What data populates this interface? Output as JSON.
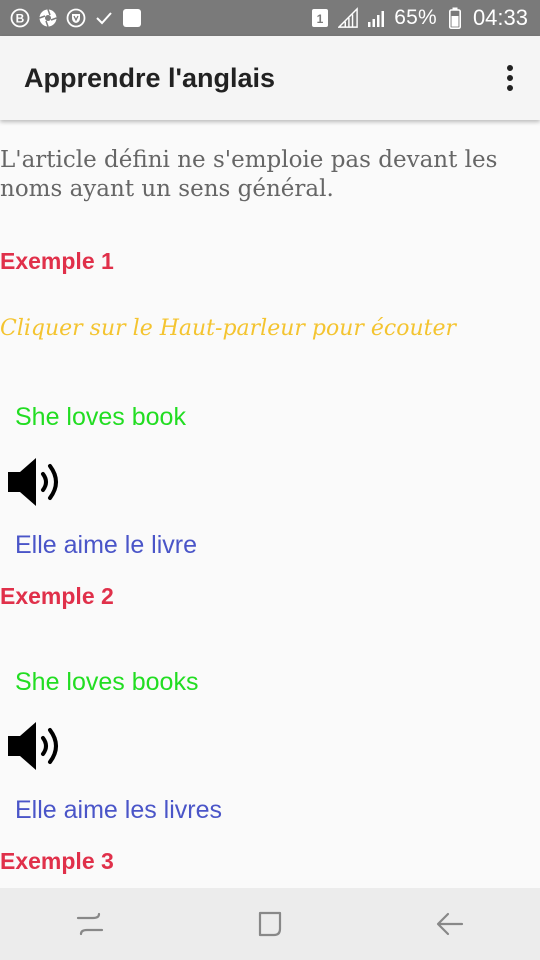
{
  "status_bar": {
    "battery_percent": "65%",
    "time": "04:33",
    "sim_slot": "1",
    "icons": [
      "b-circle-icon",
      "camera-aperture-icon",
      "shield-v-icon",
      "check-icon",
      "white-square-icon",
      "sim-icon",
      "signal-icon",
      "battery-icon"
    ]
  },
  "app_bar": {
    "title": "Apprendre l'anglais",
    "menu_icon": "more-vert-icon"
  },
  "content": {
    "intro": "L'article défini ne s'emploie pas devant les noms ayant un sens général.",
    "instruction": "Cliquer sur le Haut-parleur pour écouter",
    "examples": [
      {
        "heading": "Exemple 1",
        "english": "She loves book",
        "french": "Elle aime le livre"
      },
      {
        "heading": "Exemple 2",
        "english": "She loves books",
        "french": "Elle aime les livres"
      },
      {
        "heading": "Exemple 3"
      }
    ],
    "colors": {
      "heading": "#e0304a",
      "instruction": "#f4c430",
      "english": "#22dd22",
      "french": "#4a55c8",
      "intro": "#666666"
    }
  },
  "nav_bar": {
    "icons": [
      "recents-icon",
      "home-icon",
      "back-icon"
    ]
  }
}
